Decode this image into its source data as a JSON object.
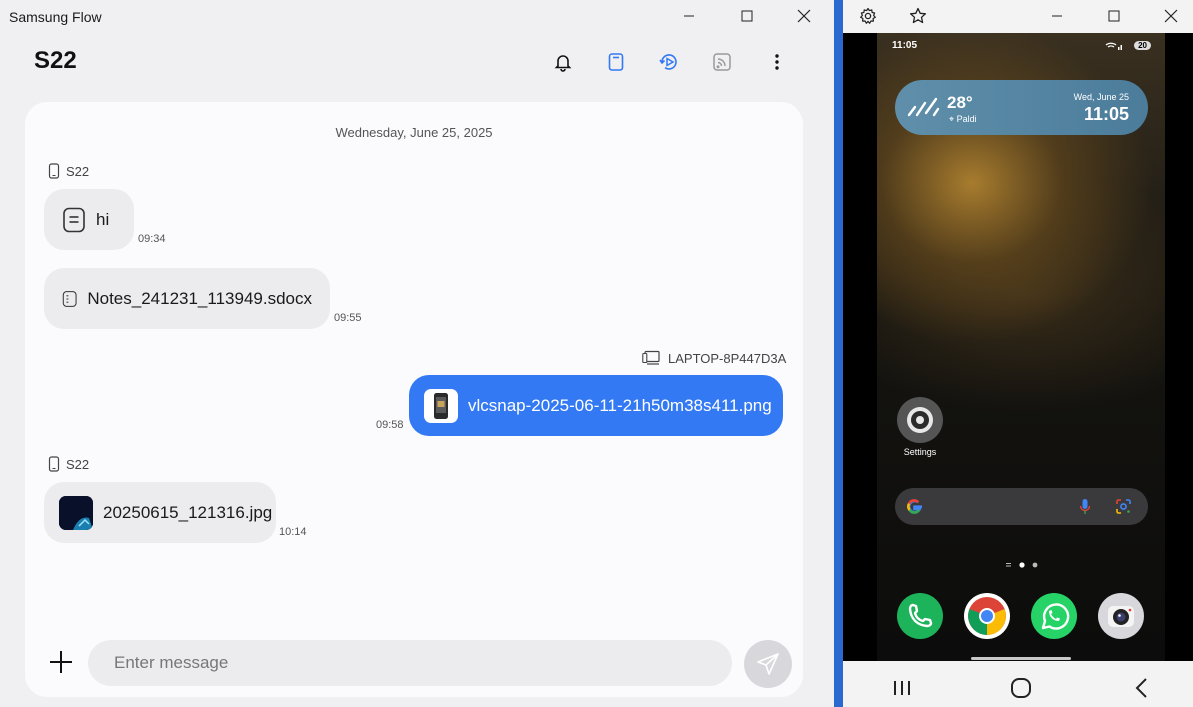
{
  "flow_window": {
    "title": "Samsung Flow",
    "controls": {
      "minimize": "minimize",
      "maximize": "maximize",
      "close": "close"
    }
  },
  "header": {
    "device_name": "S22",
    "icons": [
      "bell-icon",
      "clipboard-icon",
      "smart-view-icon",
      "cast-icon",
      "more-icon"
    ]
  },
  "chat": {
    "date": "Wednesday, June 25, 2025",
    "messages": [
      {
        "sender": "S22",
        "text": "hi",
        "time": "09:34",
        "type": "note"
      },
      {
        "sender": "S22",
        "text": "Notes_241231_113949.sdocx",
        "time": "09:55",
        "type": "file"
      },
      {
        "sender": "LAPTOP-8P447D3A",
        "text": "vlcsnap-2025-06-11-21h50m38s411.png",
        "time": "09:58",
        "type": "image-out"
      },
      {
        "sender": "S22",
        "text": "20250615_121316.jpg",
        "time": "10:14",
        "type": "image"
      }
    ]
  },
  "compose": {
    "placeholder": "Enter message"
  },
  "phone": {
    "status_time": "11:05",
    "battery": "20",
    "weather": {
      "temp": "28°",
      "location": "Paldi",
      "date": "Wed, June 25",
      "time": "11:05"
    },
    "apps": {
      "settings_label": "Settings"
    },
    "colors": {
      "accent": "#3379f3",
      "bubble": "#ececef",
      "panel": "#fbfbfd"
    }
  }
}
